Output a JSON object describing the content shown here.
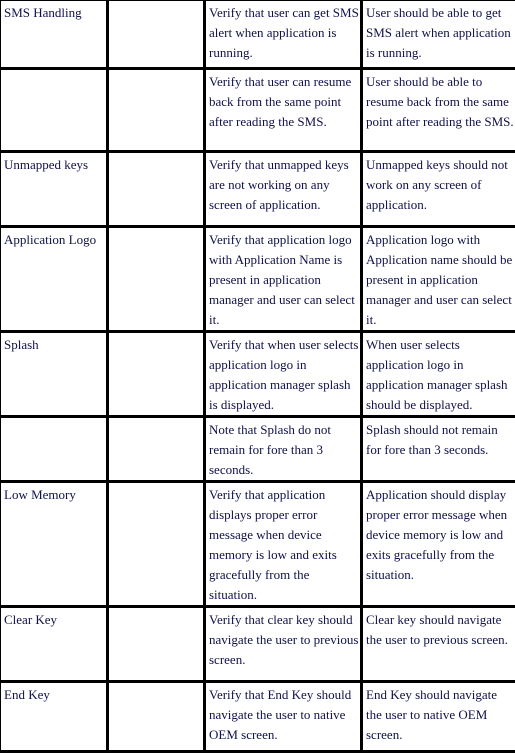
{
  "rows": [
    {
      "feature": "SMS Handling",
      "notes": "",
      "test": "Verify that user can get SMS alert when application is running.",
      "expected": "User should be able to get SMS alert when application is running."
    },
    {
      "feature": "",
      "notes": "",
      "test": "Verify that user can resume back from the same point after reading the SMS.",
      "expected": "User should be able to resume back from the same point after reading the SMS."
    },
    {
      "feature": "Unmapped keys",
      "notes": "",
      "test": "Verify that unmapped keys are not working on any screen of application.",
      "expected": "Unmapped keys should not work on any screen of application."
    },
    {
      "feature": "Application Logo",
      "notes": "",
      "test": "Verify that application logo with Application Name is present in application manager and user can select it.",
      "expected": "Application logo with Application name should be present in application manager and user can select it."
    },
    {
      "feature": "Splash",
      "notes": "",
      "test": "Verify that when user selects application logo in application manager splash is displayed.",
      "expected": "When user selects application logo in application manager splash should be displayed."
    },
    {
      "feature": "",
      "notes": "",
      "test": "Note that Splash do not remain for fore than 3 seconds.",
      "expected": "Splash should not remain for fore than 3 seconds."
    },
    {
      "feature": "Low Memory",
      "notes": "",
      "test": "Verify that application displays proper error message when device memory is low and exits gracefully from the situation.",
      "expected": "Application should display proper error message when device memory is low and exits gracefully from the situation."
    },
    {
      "feature": "Clear Key",
      "notes": "",
      "test": "Verify that clear key should navigate the user to previous screen.",
      "expected": "Clear key should navigate the user to previous screen."
    },
    {
      "feature": "End Key",
      "notes": "",
      "test": "Verify that End Key should navigate the user to native OEM screen.",
      "expected": "End Key should navigate the user to native OEM screen."
    }
  ]
}
